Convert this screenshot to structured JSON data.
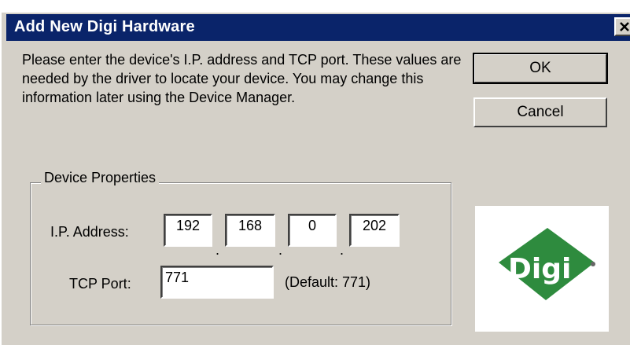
{
  "window": {
    "title": "Add New Digi Hardware",
    "close_icon": "close-icon"
  },
  "intro": {
    "text": "Please enter the device's I.P. address and TCP port. These values are needed by the driver to locate your device. You may change this information later using the Device Manager."
  },
  "buttons": {
    "ok_label": "OK",
    "cancel_label": "Cancel"
  },
  "device_properties": {
    "group_label": "Device Properties",
    "ip_label": "I.P. Address:",
    "ip_octets": [
      "192",
      "168",
      "0",
      "202"
    ],
    "ip_separator": ".",
    "tcp_label": "TCP Port:",
    "tcp_value": "771",
    "tcp_default_note": "(Default: 771)"
  },
  "logo": {
    "text": "Digi",
    "color": "#2e8b3e"
  },
  "colors": {
    "title_bar": "#0a246a",
    "dialog_bg": "#d4d0c8"
  }
}
